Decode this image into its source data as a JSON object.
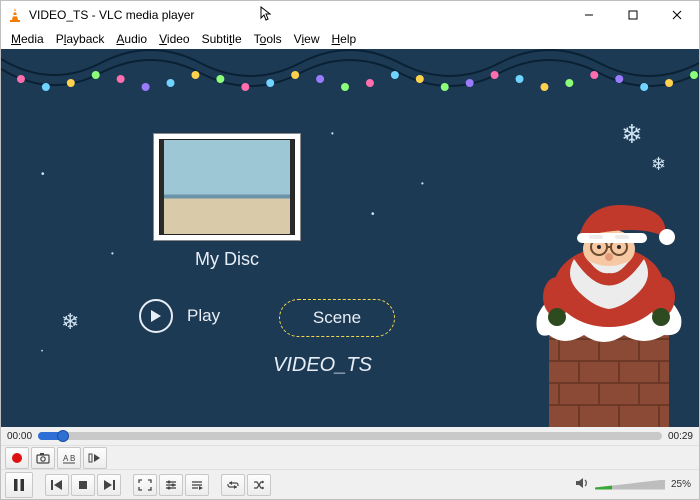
{
  "window": {
    "title": "VIDEO_TS - VLC media player"
  },
  "menus": {
    "media": {
      "label": "Media",
      "accel": "M"
    },
    "playback": {
      "label": "Playback",
      "accel": "l"
    },
    "audio": {
      "label": "Audio",
      "accel": "A"
    },
    "video": {
      "label": "Video",
      "accel": "V"
    },
    "subtitle": {
      "label": "Subtitle",
      "accel": ""
    },
    "tools": {
      "label": "Tools",
      "accel": "T"
    },
    "view": {
      "label": "View",
      "accel": "i"
    },
    "help": {
      "label": "Help",
      "accel": "H"
    }
  },
  "dvd": {
    "disc_label": "My Disc",
    "play_label": "Play",
    "scene_label": "Scene",
    "ts_label": "VIDEO_TS"
  },
  "transport": {
    "elapsed": "00:00",
    "total": "00:29",
    "progress_pct": 4
  },
  "volume": {
    "pct_label": "25%",
    "pct": 25
  }
}
